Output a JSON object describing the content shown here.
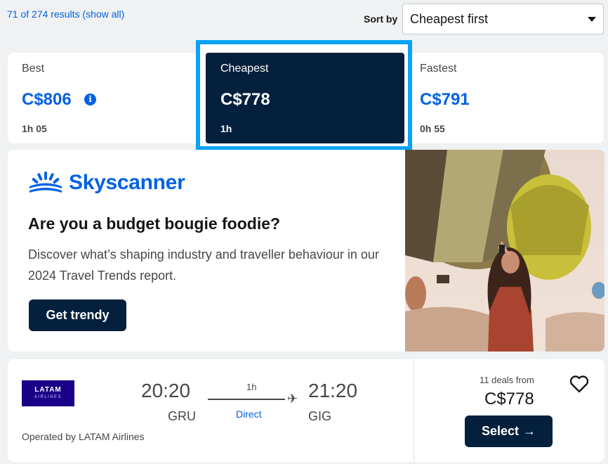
{
  "results": {
    "count_text": "71 of 274 results",
    "show_all": "(show all)"
  },
  "sort": {
    "label": "Sort by",
    "value": "Cheapest first"
  },
  "tabs": {
    "best": {
      "label": "Best",
      "price": "C$806",
      "duration": "1h 05",
      "info_icon": "i"
    },
    "cheapest": {
      "label": "Cheapest",
      "price": "C$778",
      "duration": "1h"
    },
    "fastest": {
      "label": "Fastest",
      "price": "C$791",
      "duration": "0h 55"
    }
  },
  "ad": {
    "brand": "Skyscanner",
    "headline": "Are you a budget bougie foodie?",
    "body": "Discover what’s shaping industry and traveller behaviour in our 2024 Travel Trends report.",
    "cta": "Get trendy"
  },
  "flight": {
    "airline_logo_line1": "LATAM",
    "airline_logo_line2": "AIRLINES",
    "operated_by": "Operated by LATAM Airlines",
    "depart_time": "20:20",
    "depart_airport": "GRU",
    "arrive_time": "21:20",
    "arrive_airport": "GIG",
    "duration": "1h",
    "stops": "Direct",
    "deals": "11 deals from",
    "price": "C$778",
    "select": "Select",
    "select_arrow": "→"
  },
  "colors": {
    "accent": "#0062e3",
    "dark": "#05203c",
    "highlight": "#0aa3f5"
  },
  "icons": [
    "caret-down-icon",
    "info-icon",
    "skyscanner-logo-icon",
    "plane-icon",
    "heart-icon",
    "arrow-right-icon"
  ]
}
